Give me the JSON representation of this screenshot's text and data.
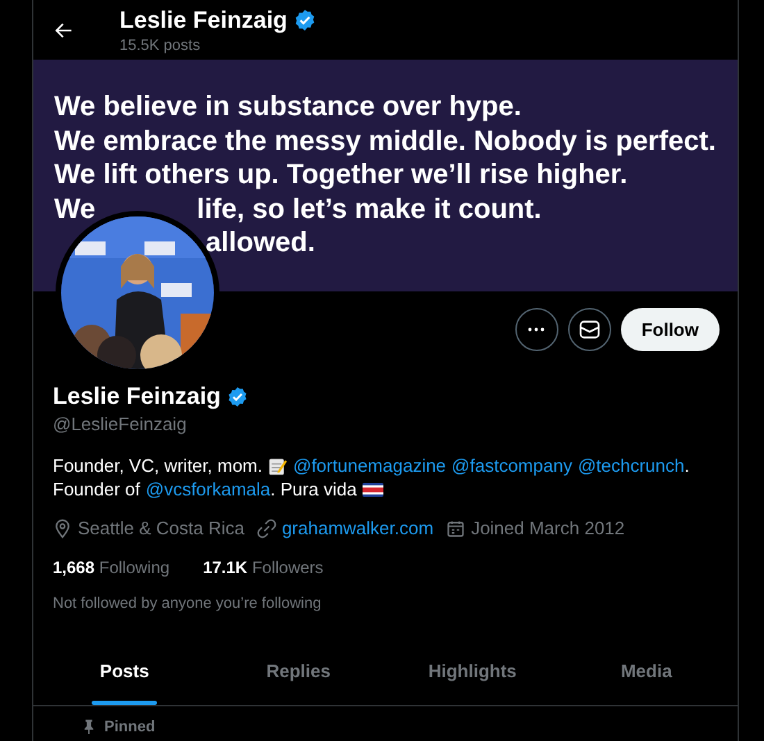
{
  "header": {
    "name": "Leslie Feinzaig",
    "verified": true,
    "posts": "15.5K posts"
  },
  "banner": {
    "lines": [
      {
        "segments": [
          "We believe in substance over hype."
        ],
        "covered_start": false
      },
      {
        "segments": [
          "We embrace the messy middle. Nobody is perfect."
        ],
        "covered_start": false
      },
      {
        "segments": [
          "We lift others up. Together we’ll rise higher."
        ],
        "covered_start": false
      },
      {
        "segments": [
          "We",
          "life, so let’s make it count."
        ],
        "covered_start": false
      },
      {
        "segments": [
          "allowed."
        ],
        "covered_start": true
      }
    ]
  },
  "actions": {
    "follow": "Follow"
  },
  "profile": {
    "name": "Leslie Feinzaig",
    "verified": true,
    "handle": "@LeslieFeinzaig"
  },
  "bio": {
    "lines": [
      [
        {
          "kind": "text",
          "text": "Founder, VC, writer, mom."
        },
        {
          "kind": "memo"
        },
        {
          "kind": "mention",
          "text": "@fortunemagazine"
        },
        {
          "kind": "mention",
          "text": "@fastcompany"
        },
        {
          "kind": "mention",
          "text": "@techcrunch"
        },
        {
          "kind": "text",
          "text": "."
        }
      ],
      [
        {
          "kind": "text",
          "text": "Founder of"
        },
        {
          "kind": "mention",
          "text": "@vcsforkamala"
        },
        {
          "kind": "text",
          "text": ". Pura vida"
        },
        {
          "kind": "flag"
        }
      ]
    ]
  },
  "meta": [
    {
      "kind": "location",
      "text": "Seattle & Costa Rica"
    },
    {
      "kind": "website",
      "text": "grahamwalker.com"
    },
    {
      "kind": "joined",
      "text": "Joined March 2012"
    }
  ],
  "stats": [
    {
      "value": "1,668",
      "label": "Following"
    },
    {
      "value": "17.1K",
      "label": "Followers"
    }
  ],
  "followed_by": "Not followed by anyone you’re following",
  "tabs": [
    {
      "label": "Posts",
      "selected": true
    },
    {
      "label": "Replies",
      "selected": false
    },
    {
      "label": "Highlights",
      "selected": false
    },
    {
      "label": "Media",
      "selected": false
    }
  ],
  "pinned": "Pinned"
}
